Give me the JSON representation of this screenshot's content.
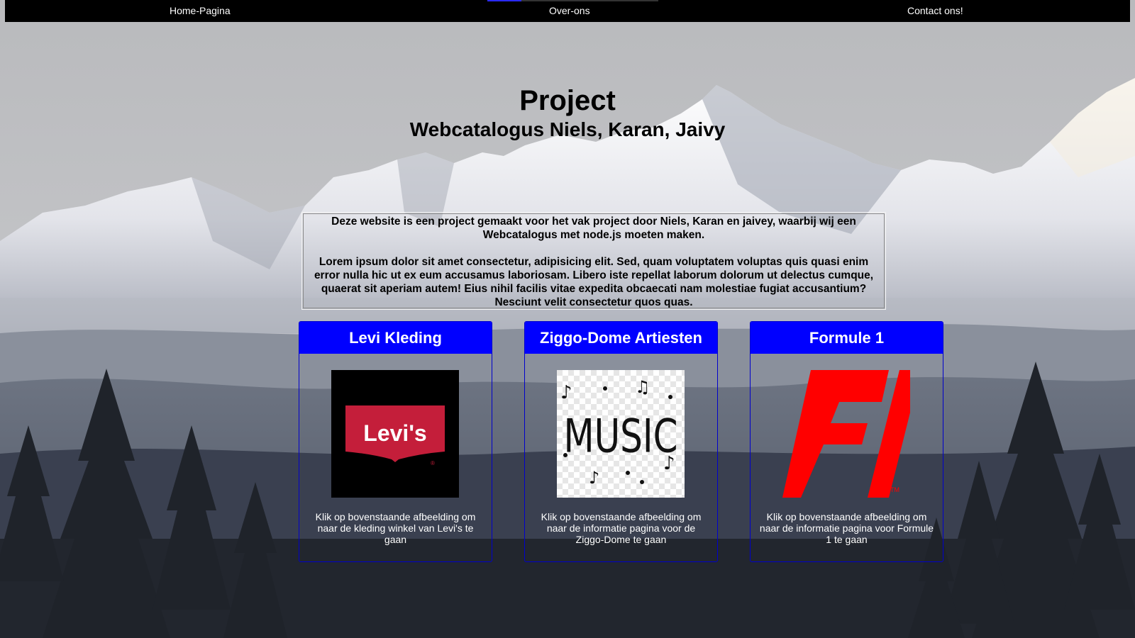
{
  "nav": {
    "home": "Home-Pagina",
    "about": "Over-ons",
    "contact": "Contact ons!"
  },
  "hero": {
    "title": "Project",
    "subtitle": "Webcatalogus Niels, Karan, Jaivy"
  },
  "intro": {
    "paragraph1": "Deze website is een project gemaakt voor het vak project door Niels, Karan en jaivey, waarbij wij een Webcatalogus met node.js moeten maken.",
    "paragraph2": "Lorem ipsum dolor sit amet consectetur, adipisicing elit. Sed, quam voluptatem voluptas quis quasi enim error nulla hic ut ex eum accusamus laboriosam. Libero iste repellat laborum dolorum ut delectus cumque, quaerat sit aperiam autem! Eius nihil facilis vitae expedita obcaecati nam molestiae fugiat accusantium? Nesciunt velit consectetur quos quas."
  },
  "cards": [
    {
      "title": "Levi Kleding",
      "image": "levis-logo",
      "logo_text": "Levi's",
      "caption": "Klik op bovenstaande afbeelding om naar de kleding winkel van Levi's te gaan"
    },
    {
      "title": "Ziggo-Dome Artiesten",
      "image": "music-notes-logo",
      "logo_text": "MUSIC",
      "caption": "Klik op bovenstaande afbeelding om naar de informatie pagina voor de Ziggo-Dome te gaan"
    },
    {
      "title": "Formule 1",
      "image": "f1-logo",
      "logo_text": "F1",
      "caption": "Klik op bovenstaande afbeelding om naar de informatie pagina voor Formule 1 te gaan"
    }
  ],
  "colors": {
    "navbar": "#000000",
    "card_header": "#0000ff",
    "card_border": "#0000cc",
    "levis_red": "#c41e3a",
    "f1_red": "#ff0000"
  }
}
